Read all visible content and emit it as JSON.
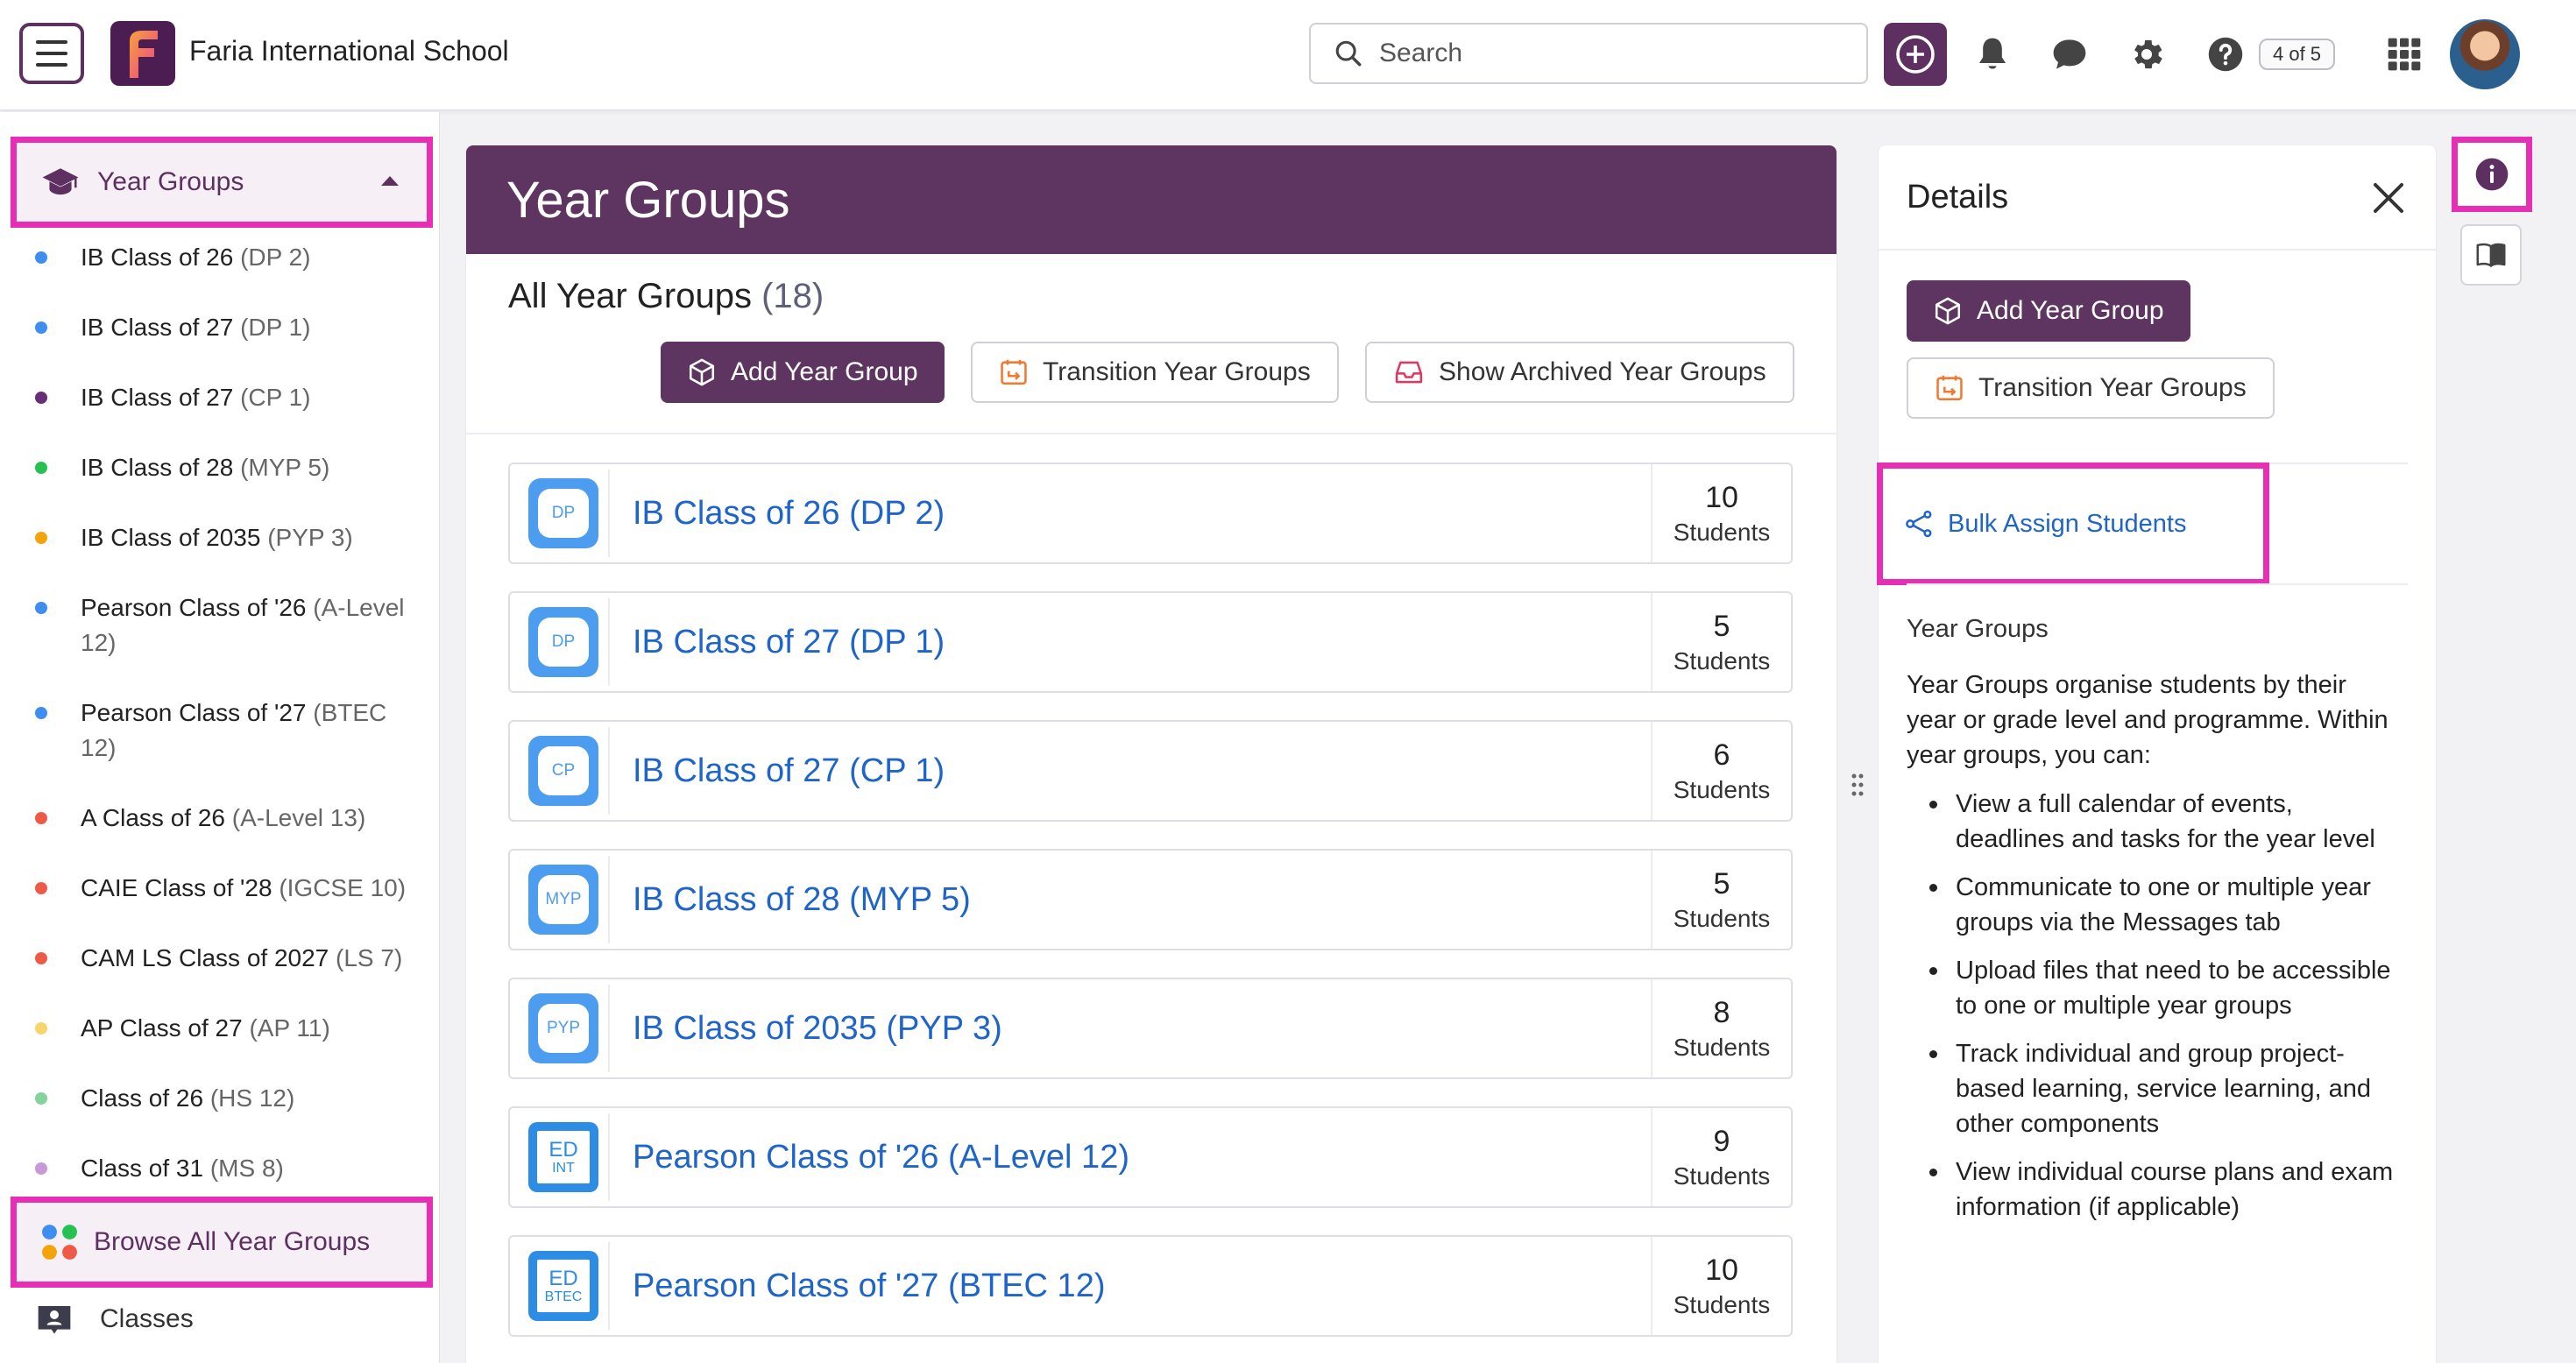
{
  "header": {
    "school_name": "Faria International School",
    "search_placeholder": "Search",
    "counter_badge": "4 of 5"
  },
  "sidebar": {
    "section_label": "Year Groups",
    "items": [
      {
        "name": "IB Class of 26",
        "code": "(DP 2)",
        "dot": "#3d8ef0"
      },
      {
        "name": "IB Class of 27",
        "code": "(DP 1)",
        "dot": "#3d8ef0"
      },
      {
        "name": "IB Class of 27",
        "code": "(CP 1)",
        "dot": "#6a2d77"
      },
      {
        "name": "IB Class of 28",
        "code": "(MYP 5)",
        "dot": "#27c152"
      },
      {
        "name": "IB Class of 2035",
        "code": "(PYP 3)",
        "dot": "#f5a30b"
      },
      {
        "name": "Pearson Class of '26",
        "code": "(A-Level 12)",
        "dot": "#3d8ef0"
      },
      {
        "name": "Pearson Class of '27",
        "code": "(BTEC 12)",
        "dot": "#3d8ef0"
      },
      {
        "name": "A Class of 26",
        "code": "(A-Level 13)",
        "dot": "#ef5a47"
      },
      {
        "name": "CAIE Class of '28",
        "code": "(IGCSE 10)",
        "dot": "#ef5a47"
      },
      {
        "name": "CAM LS Class of 2027",
        "code": "(LS 7)",
        "dot": "#ef5a47"
      },
      {
        "name": "AP Class of 27",
        "code": "(AP 11)",
        "dot": "#f8d56a"
      },
      {
        "name": "Class of 26",
        "code": "(HS 12)",
        "dot": "#84d39a"
      },
      {
        "name": "Class of 31",
        "code": "(MS 8)",
        "dot": "#c898d8"
      }
    ],
    "browse_label": "Browse All Year Groups",
    "classes_label": "Classes"
  },
  "main": {
    "title": "Year Groups",
    "list_title": "All Year Groups",
    "list_count": "(18)",
    "add_button": "Add Year Group",
    "transition_button": "Transition Year Groups",
    "archived_button": "Show Archived Year Groups",
    "students_label": "Students",
    "rows": [
      {
        "name": "IB Class of 26 (DP 2)",
        "badge": "DP",
        "badge_type": "ib",
        "count": "10"
      },
      {
        "name": "IB Class of 27 (DP 1)",
        "badge": "DP",
        "badge_type": "ib",
        "count": "5"
      },
      {
        "name": "IB Class of 27 (CP 1)",
        "badge": "CP",
        "badge_type": "ib",
        "count": "6"
      },
      {
        "name": "IB Class of 28 (MYP 5)",
        "badge": "MYP",
        "badge_type": "ib",
        "count": "5"
      },
      {
        "name": "IB Class of 2035 (PYP 3)",
        "badge": "PYP",
        "badge_type": "ib",
        "count": "8"
      },
      {
        "name": "Pearson Class of '26 (A-Level 12)",
        "badge": "ED",
        "badge_sub": "INT",
        "badge_type": "ed",
        "count": "9"
      },
      {
        "name": "Pearson Class of '27 (BTEC 12)",
        "badge": "ED",
        "badge_sub": "BTEC",
        "badge_type": "ed",
        "count": "10"
      }
    ]
  },
  "details": {
    "title": "Details",
    "add_button": "Add Year Group",
    "transition_button": "Transition Year Groups",
    "bulk_assign": "Bulk Assign Students",
    "section_title": "Year Groups",
    "intro": "Year Groups organise students by their year or grade level and programme. Within year groups, you can:",
    "bullets": [
      "View a full calendar of events, deadlines and tasks for the year level",
      "Communicate to one or multiple year groups via the Messages tab",
      "Upload files that need to be accessible to one or multiple year groups",
      "Track individual and group project-based learning, service learning, and other components",
      "View individual course plans and exam information (if applicable)"
    ]
  },
  "colors": {
    "brand_purple": "#5e3461",
    "highlight_pink": "#e72fb5",
    "link_blue": "#1f64c8"
  }
}
